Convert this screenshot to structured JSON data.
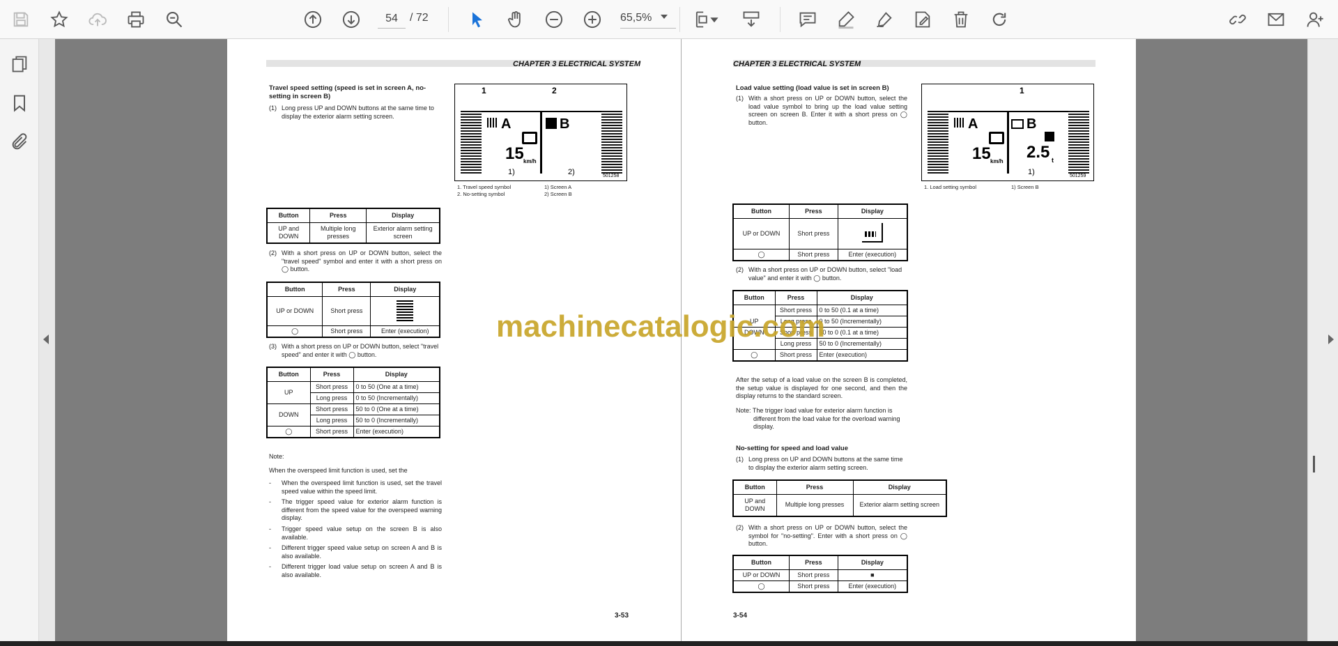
{
  "toolbar": {
    "page_current": "54",
    "page_total": "/  72",
    "zoom": "65,5%"
  },
  "watermark": "machinecatalogic.com",
  "left_page": {
    "header": "CHAPTER 3 ELECTRICAL SYSTEM",
    "heading": "Travel speed setting (speed is set in screen A, no-setting in screen B)",
    "step1_num": "(1)",
    "step1": "Long press UP and DOWN buttons at the same time to display the exterior alarm setting screen.",
    "figure": {
      "callout1": "1",
      "callout2": "2",
      "screen_a": "A",
      "screen_b": "B",
      "speed": "15",
      "unit": "km/h",
      "label1": "1)",
      "label2": "2)",
      "code": "501258",
      "captions": [
        "1. Travel speed symbol",
        "2. No-setting symbol",
        "1) Screen A",
        "2) Screen B"
      ]
    },
    "table1": {
      "headers": [
        "Button",
        "Press",
        "Display"
      ],
      "rows": [
        [
          "UP and DOWN",
          "Multiple long presses",
          "Exterior alarm setting screen"
        ]
      ]
    },
    "step2_num": "(2)",
    "step2": "With a short press on UP or DOWN button, select the \"travel speed\" symbol and enter it with a short press on ◯ button.",
    "table2": {
      "headers": [
        "Button",
        "Press",
        "Display"
      ],
      "rows": [
        [
          "UP or DOWN",
          "Short press",
          ""
        ],
        [
          "◯",
          "Short press",
          "Enter (execution)"
        ]
      ]
    },
    "step3_num": "(3)",
    "step3": "With a short press on UP or DOWN button, select \"travel speed\" and enter it with ◯ button.",
    "table3": {
      "headers": [
        "Button",
        "Press",
        "Display"
      ],
      "up": "UP",
      "down": "DOWN",
      "circle": "◯",
      "rows": [
        [
          "Short press",
          "0 to 50 (One at a time)"
        ],
        [
          "Long press",
          "0 to 50 (Incrementally)"
        ],
        [
          "Short press",
          "50 to 0 (One at a time)"
        ],
        [
          "Long press",
          "50 to 0 (Incrementally)"
        ],
        [
          "Short press",
          "Enter (execution)"
        ]
      ]
    },
    "note_title": "Note:",
    "note_intro": "When the overspeed limit function is used, set the",
    "bullets": [
      "When the overspeed limit function is used, set the travel speed value within the speed limit.",
      "The trigger speed value for exterior alarm function is different from the speed value for the overspeed warning display.",
      "Trigger speed value setup on the screen B is also available.",
      "Different trigger speed value setup on screen A and B is also available.",
      "Different trigger load value setup on screen A and B is also available."
    ],
    "page_number": "3-53"
  },
  "right_page": {
    "header": "CHAPTER 3 ELECTRICAL SYSTEM",
    "heading": "Load value setting (load value is set in screen B)",
    "step1_num": "(1)",
    "step1": "With a short press on UP or DOWN button, select the load value symbol to bring up the load value setting screen on screen B. Enter it with a short press on ◯ button.",
    "figure": {
      "callout1": "1",
      "screen_a": "A",
      "screen_b": "B",
      "speed": "15",
      "unit": "km/h",
      "load": "2.5",
      "load_unit": "t",
      "label1": "1)",
      "code": "501259",
      "captions": [
        "1. Load setting symbol",
        "1) Screen B"
      ]
    },
    "table1": {
      "headers": [
        "Button",
        "Press",
        "Display"
      ],
      "rows": [
        [
          "UP or DOWN",
          "Short press",
          ""
        ],
        [
          "◯",
          "Short press",
          "Enter (execution)"
        ]
      ]
    },
    "step2_num": "(2)",
    "step2": "With a short press on UP or DOWN button, select \"load value\" and enter it with ◯ button.",
    "table2": {
      "headers": [
        "Button",
        "Press",
        "Display"
      ],
      "up": "UP",
      "down": "DOWN",
      "circle": "◯",
      "rows": [
        [
          "Short press",
          "0 to 50 (0.1 at a time)"
        ],
        [
          "Long press",
          "0 to 50 (Incrementally)"
        ],
        [
          "Short press",
          "50 to 0 (0.1 at a time)"
        ],
        [
          "Long press",
          "50 to 0 (Incrementally)"
        ],
        [
          "Short press",
          "Enter (execution)"
        ]
      ]
    },
    "after": "After the setup of a load value on the screen B is completed, the setup value is displayed for one second, and then the display returns to the standard screen.",
    "note": "Note: The trigger load value for exterior alarm function is different from the load value for the overload warning display.",
    "heading2": "No-setting for speed and load value",
    "step3_num": "(1)",
    "step3": "Long press on UP and DOWN buttons at the same time to display the exterior alarm setting screen.",
    "table3": {
      "headers": [
        "Button",
        "Press",
        "Display"
      ],
      "rows": [
        [
          "UP and DOWN",
          "Multiple long presses",
          "Exterior alarm setting screen"
        ]
      ]
    },
    "step4_num": "(2)",
    "step4": "With a short press on UP or DOWN button, select the symbol for \"no-setting\". Enter with a short press on ◯ button.",
    "table4": {
      "headers": [
        "Button",
        "Press",
        "Display"
      ],
      "rows": [
        [
          "UP or DOWN",
          "Short press",
          "■"
        ],
        [
          "◯",
          "Short press",
          "Enter (execution)"
        ]
      ]
    },
    "page_number": "3-54"
  }
}
